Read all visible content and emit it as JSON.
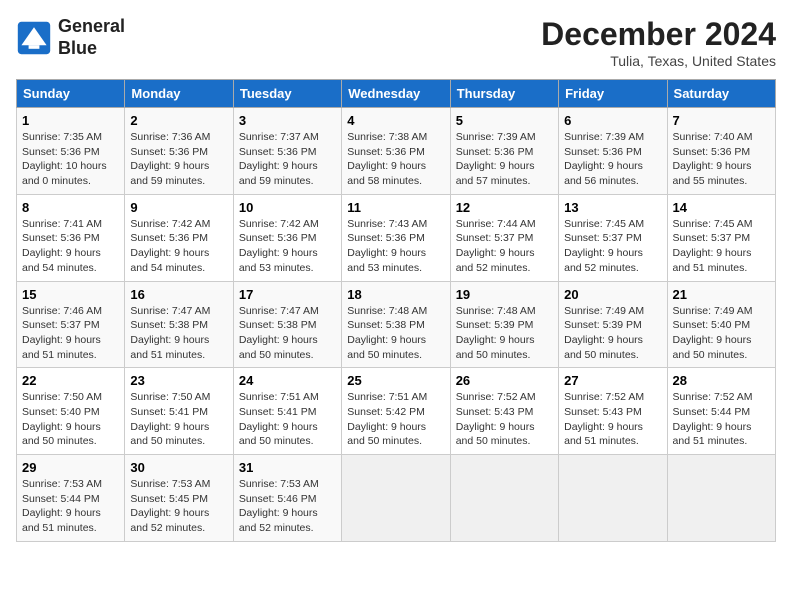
{
  "logo": {
    "line1": "General",
    "line2": "Blue"
  },
  "title": "December 2024",
  "subtitle": "Tulia, Texas, United States",
  "days_of_week": [
    "Sunday",
    "Monday",
    "Tuesday",
    "Wednesday",
    "Thursday",
    "Friday",
    "Saturday"
  ],
  "weeks": [
    [
      {
        "day": "1",
        "sunrise": "7:35 AM",
        "sunset": "5:36 PM",
        "daylight": "10 hours and 0 minutes."
      },
      {
        "day": "2",
        "sunrise": "7:36 AM",
        "sunset": "5:36 PM",
        "daylight": "9 hours and 59 minutes."
      },
      {
        "day": "3",
        "sunrise": "7:37 AM",
        "sunset": "5:36 PM",
        "daylight": "9 hours and 59 minutes."
      },
      {
        "day": "4",
        "sunrise": "7:38 AM",
        "sunset": "5:36 PM",
        "daylight": "9 hours and 58 minutes."
      },
      {
        "day": "5",
        "sunrise": "7:39 AM",
        "sunset": "5:36 PM",
        "daylight": "9 hours and 57 minutes."
      },
      {
        "day": "6",
        "sunrise": "7:39 AM",
        "sunset": "5:36 PM",
        "daylight": "9 hours and 56 minutes."
      },
      {
        "day": "7",
        "sunrise": "7:40 AM",
        "sunset": "5:36 PM",
        "daylight": "9 hours and 55 minutes."
      }
    ],
    [
      {
        "day": "8",
        "sunrise": "7:41 AM",
        "sunset": "5:36 PM",
        "daylight": "9 hours and 54 minutes."
      },
      {
        "day": "9",
        "sunrise": "7:42 AM",
        "sunset": "5:36 PM",
        "daylight": "9 hours and 54 minutes."
      },
      {
        "day": "10",
        "sunrise": "7:42 AM",
        "sunset": "5:36 PM",
        "daylight": "9 hours and 53 minutes."
      },
      {
        "day": "11",
        "sunrise": "7:43 AM",
        "sunset": "5:36 PM",
        "daylight": "9 hours and 53 minutes."
      },
      {
        "day": "12",
        "sunrise": "7:44 AM",
        "sunset": "5:37 PM",
        "daylight": "9 hours and 52 minutes."
      },
      {
        "day": "13",
        "sunrise": "7:45 AM",
        "sunset": "5:37 PM",
        "daylight": "9 hours and 52 minutes."
      },
      {
        "day": "14",
        "sunrise": "7:45 AM",
        "sunset": "5:37 PM",
        "daylight": "9 hours and 51 minutes."
      }
    ],
    [
      {
        "day": "15",
        "sunrise": "7:46 AM",
        "sunset": "5:37 PM",
        "daylight": "9 hours and 51 minutes."
      },
      {
        "day": "16",
        "sunrise": "7:47 AM",
        "sunset": "5:38 PM",
        "daylight": "9 hours and 51 minutes."
      },
      {
        "day": "17",
        "sunrise": "7:47 AM",
        "sunset": "5:38 PM",
        "daylight": "9 hours and 50 minutes."
      },
      {
        "day": "18",
        "sunrise": "7:48 AM",
        "sunset": "5:38 PM",
        "daylight": "9 hours and 50 minutes."
      },
      {
        "day": "19",
        "sunrise": "7:48 AM",
        "sunset": "5:39 PM",
        "daylight": "9 hours and 50 minutes."
      },
      {
        "day": "20",
        "sunrise": "7:49 AM",
        "sunset": "5:39 PM",
        "daylight": "9 hours and 50 minutes."
      },
      {
        "day": "21",
        "sunrise": "7:49 AM",
        "sunset": "5:40 PM",
        "daylight": "9 hours and 50 minutes."
      }
    ],
    [
      {
        "day": "22",
        "sunrise": "7:50 AM",
        "sunset": "5:40 PM",
        "daylight": "9 hours and 50 minutes."
      },
      {
        "day": "23",
        "sunrise": "7:50 AM",
        "sunset": "5:41 PM",
        "daylight": "9 hours and 50 minutes."
      },
      {
        "day": "24",
        "sunrise": "7:51 AM",
        "sunset": "5:41 PM",
        "daylight": "9 hours and 50 minutes."
      },
      {
        "day": "25",
        "sunrise": "7:51 AM",
        "sunset": "5:42 PM",
        "daylight": "9 hours and 50 minutes."
      },
      {
        "day": "26",
        "sunrise": "7:52 AM",
        "sunset": "5:43 PM",
        "daylight": "9 hours and 50 minutes."
      },
      {
        "day": "27",
        "sunrise": "7:52 AM",
        "sunset": "5:43 PM",
        "daylight": "9 hours and 51 minutes."
      },
      {
        "day": "28",
        "sunrise": "7:52 AM",
        "sunset": "5:44 PM",
        "daylight": "9 hours and 51 minutes."
      }
    ],
    [
      {
        "day": "29",
        "sunrise": "7:53 AM",
        "sunset": "5:44 PM",
        "daylight": "9 hours and 51 minutes."
      },
      {
        "day": "30",
        "sunrise": "7:53 AM",
        "sunset": "5:45 PM",
        "daylight": "9 hours and 52 minutes."
      },
      {
        "day": "31",
        "sunrise": "7:53 AM",
        "sunset": "5:46 PM",
        "daylight": "9 hours and 52 minutes."
      },
      null,
      null,
      null,
      null
    ]
  ]
}
